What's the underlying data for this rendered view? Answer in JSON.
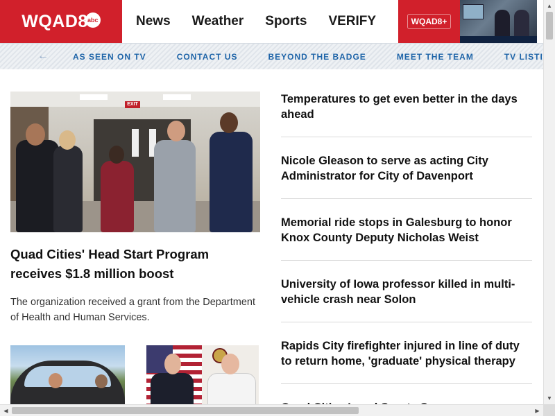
{
  "header": {
    "logo_text": "WQAD8",
    "logo_badge": "abc",
    "nav": [
      "News",
      "Weather",
      "Sports",
      "VERIFY"
    ],
    "plus_label": "WQAD8+",
    "colors": {
      "brand_red": "#d1202b",
      "link_blue": "#1e64a8"
    }
  },
  "subnav": {
    "back_icon": "arrow-left-icon",
    "items": [
      "AS SEEN ON TV",
      "CONTACT US",
      "BEYOND THE BADGE",
      "MEET THE TEAM",
      "TV LISTINGS"
    ]
  },
  "lead": {
    "title": "Quad Cities' Head Start Program receives $1.8 million boost",
    "description": "The organization received a grant from the Department of Health and Human Services.",
    "image_text": "EXIT"
  },
  "headlines": [
    "Temperatures to get even better in the days ahead",
    "Nicole Gleason to serve as acting City Administrator for City of Davenport",
    "Memorial ride stops in Galesburg to honor Knox County Deputy Nicholas Weist",
    "University of Iowa professor killed in multi-vehicle crash near Solon",
    "Rapids City firefighter injured in line of duty to return home, 'graduate' physical therapy",
    "Quad Cities Local Sports Scores"
  ]
}
